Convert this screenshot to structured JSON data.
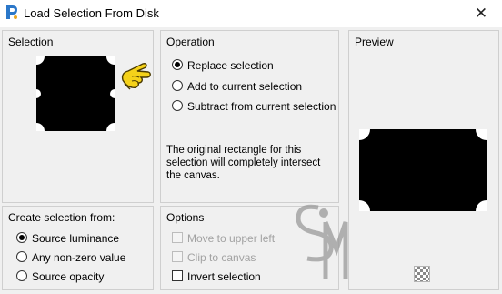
{
  "window": {
    "title": "Load Selection From Disk"
  },
  "selection_panel": {
    "label": "Selection"
  },
  "operation_panel": {
    "label": "Operation",
    "options": [
      {
        "label": "Replace selection",
        "checked": true
      },
      {
        "label": "Add to current selection",
        "checked": false
      },
      {
        "label": "Subtract from current selection",
        "checked": false
      }
    ],
    "note": "The original rectangle for this selection will completely intersect the canvas."
  },
  "preview_panel": {
    "label": "Preview"
  },
  "create_panel": {
    "label": "Create selection from:",
    "options": [
      {
        "label": "Source luminance",
        "checked": true
      },
      {
        "label": "Any non-zero value",
        "checked": false
      },
      {
        "label": "Source opacity",
        "checked": false
      }
    ]
  },
  "options_panel": {
    "label": "Options",
    "checks": [
      {
        "label": "Move to upper left",
        "checked": false,
        "enabled": false
      },
      {
        "label": "Clip to canvas",
        "checked": false,
        "enabled": false
      },
      {
        "label": "Invert selection",
        "checked": false,
        "enabled": true
      }
    ]
  },
  "watermark": {
    "text": "SIM"
  },
  "icons": {
    "app": "app-icon",
    "close": "close-icon",
    "pointer": "pointing-hand-icon",
    "transparency": "transparency-checker-icon"
  }
}
